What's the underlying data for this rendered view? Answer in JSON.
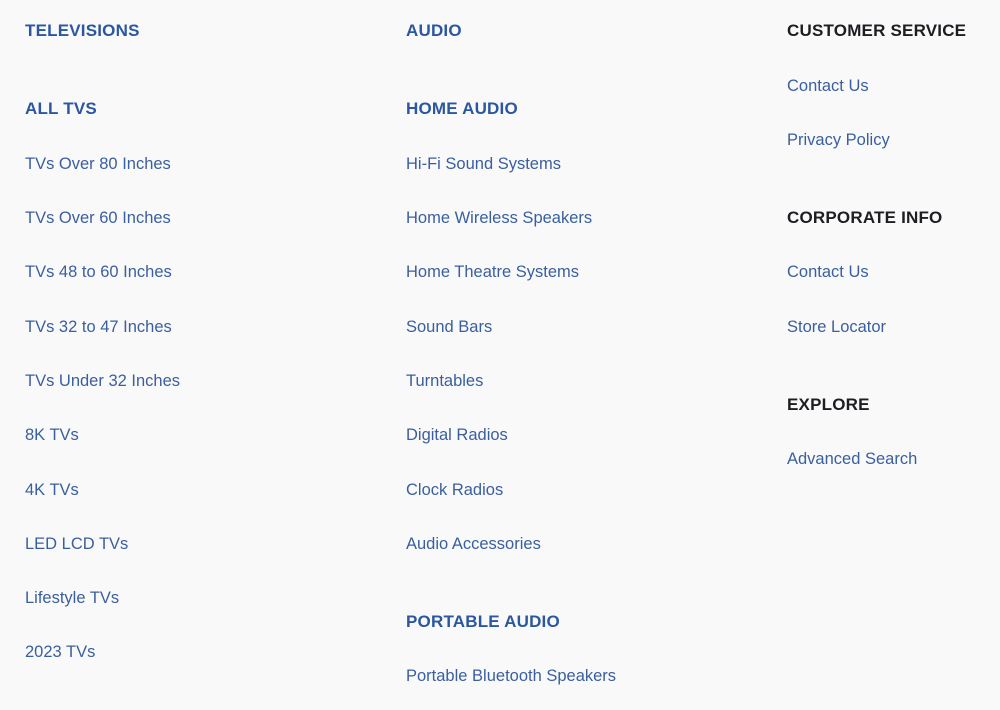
{
  "columns": [
    {
      "title": "TELEVISIONS",
      "groups": [
        {
          "heading": "ALL TVS",
          "links": [
            "TVs Over 80 Inches",
            "TVs Over 60 Inches",
            "TVs 48 to 60 Inches",
            "TVs 32 to 47 Inches",
            "TVs Under 32 Inches",
            "8K TVs",
            "4K TVs",
            "LED LCD TVs",
            "Lifestyle TVs",
            "2023 TVs"
          ]
        }
      ]
    },
    {
      "title": "AUDIO",
      "groups": [
        {
          "heading": "HOME AUDIO",
          "links": [
            "Hi-Fi Sound Systems",
            "Home Wireless Speakers",
            "Home Theatre Systems",
            "Sound Bars",
            "Turntables",
            "Digital Radios",
            "Clock Radios",
            "Audio Accessories"
          ]
        },
        {
          "heading": "PORTABLE AUDIO",
          "links": [
            "Portable Bluetooth Speakers"
          ]
        }
      ]
    },
    {
      "groups": [
        {
          "heading": "CUSTOMER SERVICE",
          "links": [
            "Contact Us",
            "Privacy Policy"
          ]
        },
        {
          "heading": "CORPORATE INFO",
          "links": [
            "Contact Us",
            "Store Locator"
          ]
        },
        {
          "heading": "EXPLORE",
          "links": [
            "Advanced Search"
          ]
        }
      ]
    }
  ],
  "colors": {
    "heading_blue": "#2b56a0",
    "heading_dark": "#1e1e22",
    "link": "#3a5f9e",
    "background": "#f9f9fa"
  }
}
